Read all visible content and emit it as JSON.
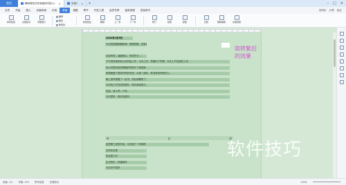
{
  "titlebar": {
    "home": "首页",
    "tabs": [
      {
        "label": "瞬间修改文件前面的内容(1)"
      },
      {
        "label": "文档1"
      }
    ],
    "add": "+"
  },
  "menu": {
    "items": [
      "文件",
      "开始",
      "插入",
      "页面布局",
      "引用",
      "审阅",
      "视图",
      "章节",
      "开发工具",
      "会员专享",
      "稻壳资源"
    ],
    "active_index": 5,
    "search": "查找命令",
    "right": [
      "未同步",
      "分享",
      "批注"
    ]
  },
  "ribbon": {
    "groups": [
      {
        "label": "拼写检查"
      },
      {
        "label": "文档校对"
      },
      {
        "label": "字数统计"
      }
    ],
    "small": [
      "翻译",
      "朗读",
      "繁转简"
    ],
    "groups2": [
      {
        "label": "新建批注"
      },
      {
        "label": "删除"
      },
      {
        "label": "上一条"
      },
      {
        "label": "下一条"
      },
      {
        "label": "修订"
      },
      {
        "label": "接受"
      },
      {
        "label": "拒绝"
      },
      {
        "label": "比较"
      },
      {
        "label": "限制编辑"
      },
      {
        "label": "文档权限"
      }
    ]
  },
  "document": {
    "heading": "2020年1月8日",
    "lines": [
      "今日吃饭看剧看新闻，很是舒服，没有做的……",
      "",
      "北京时间，凌晨两点，完成作业……",
      "下午的时候来到公司开始工作，今天工作，早晨吃了早餐，今天上午完成的工作。",
      "在公司里加班到很晚的时候才下班回家，",
      "家里面做了很多好吃的东西，大家一起吃，有说有笑的很开心。",
      "晚上的时候看了一会书，然后就睡觉了。",
      "今天的工作完成的很好，明天继续努力。",
      "加油，奋斗吧，少年。",
      "今天很好，明天会更好。"
    ],
    "red_note": "简转繁后的效果",
    "table_rows": [
      [
        "时",
        "日",
        "时"
      ],
      [
        "",
        "",
        ""
      ]
    ],
    "tail_lines": [
      "这是第三段的内容，今天做了一些事情",
      "文件在这里",
      "在这里工作",
      "生日快乐，祝福语句",
      "今天天气真好"
    ]
  },
  "statusbar": {
    "page": "页面: 1/1",
    "words": "字数: 425",
    "spell": "拼写检查",
    "doc_check": "文档校对",
    "zoom": "100%"
  },
  "watermark": "软件技巧"
}
